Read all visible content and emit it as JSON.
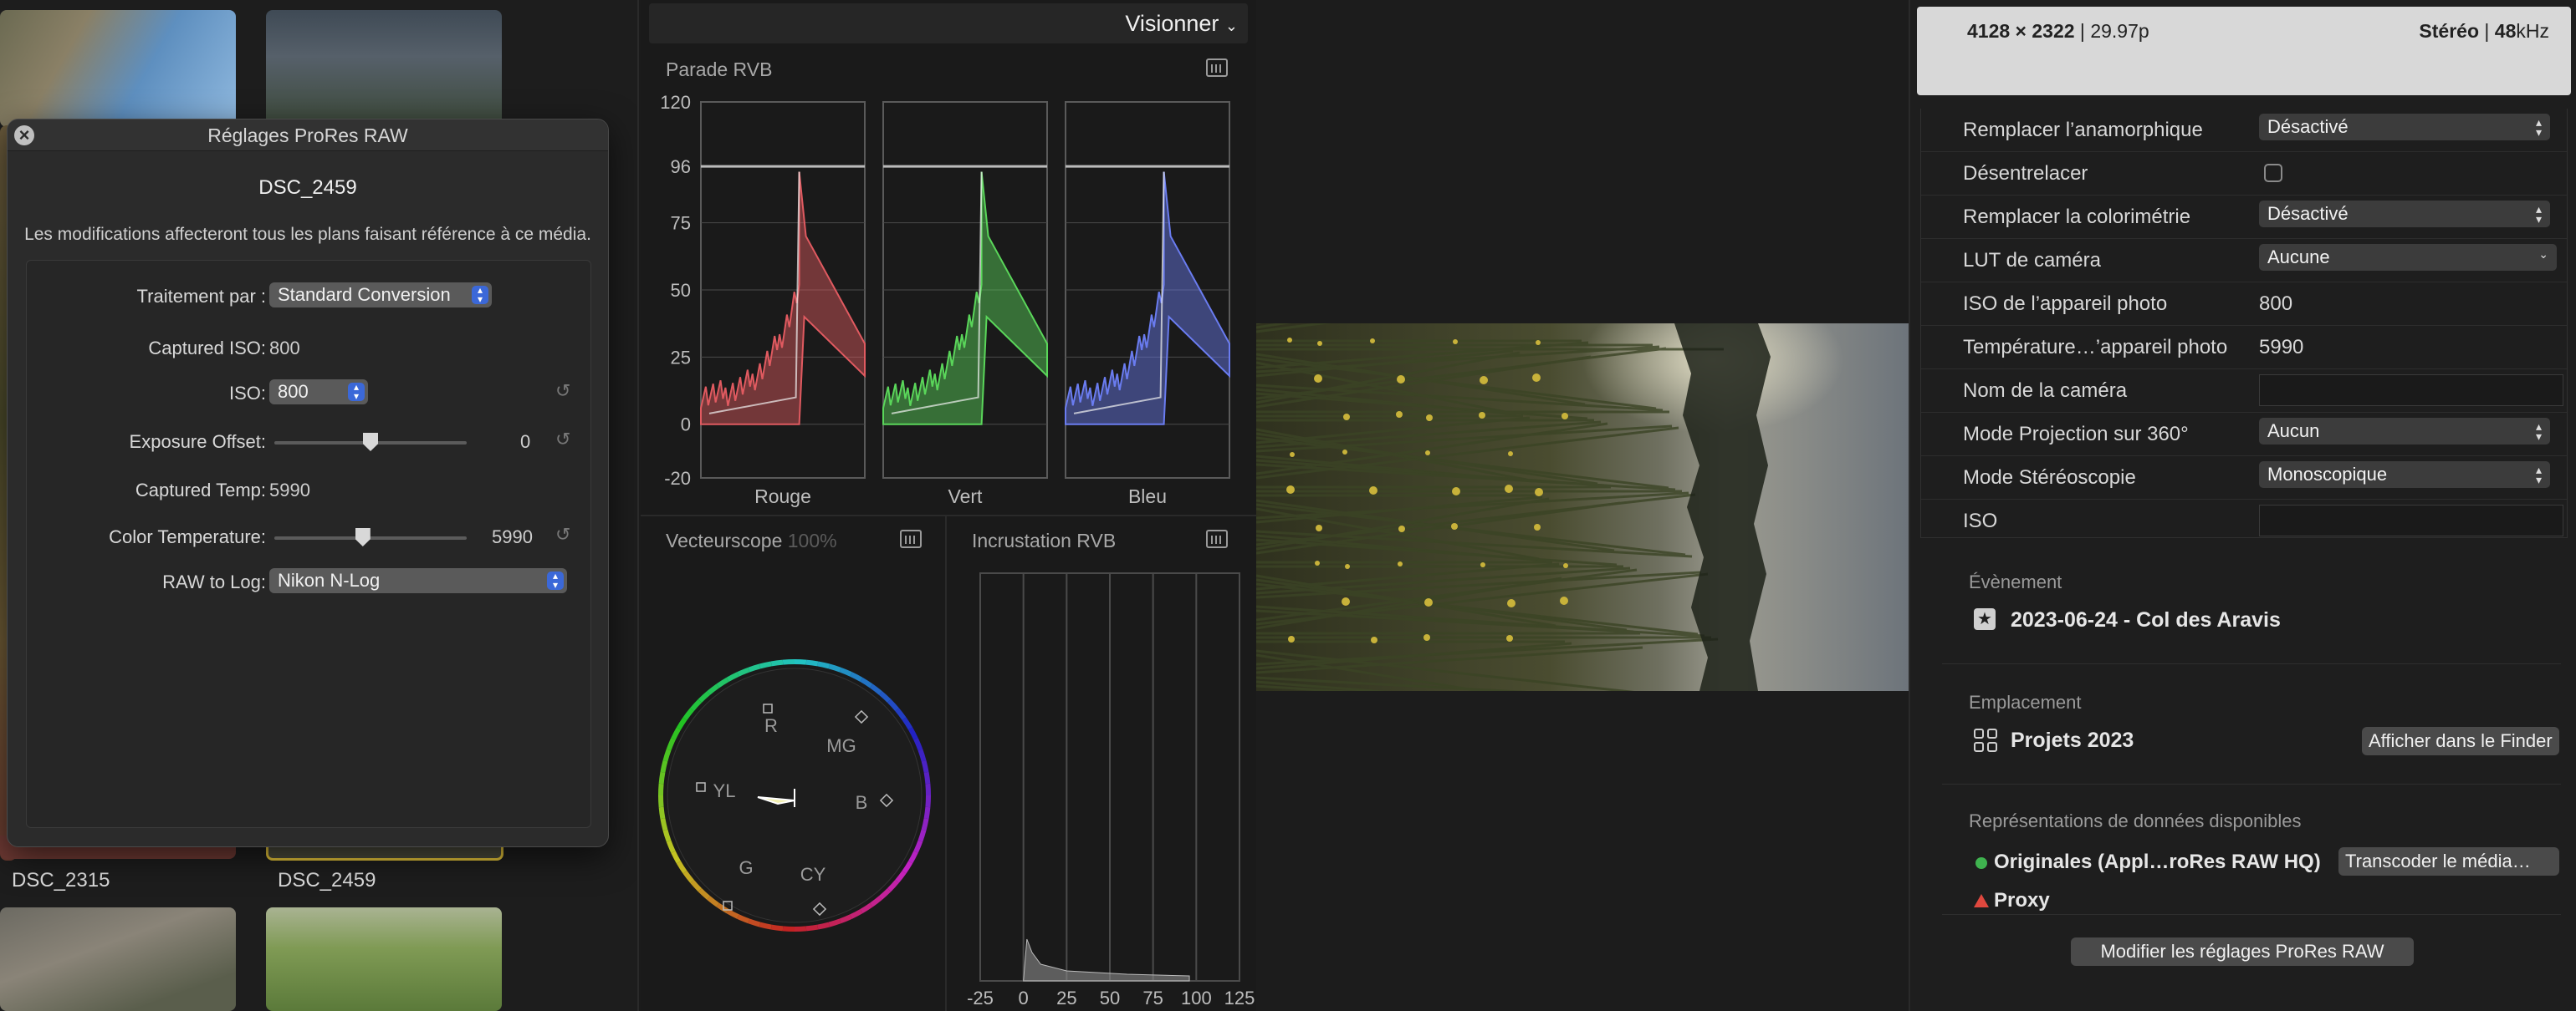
{
  "browser": {
    "clips": [
      {
        "name": "DSC_2315"
      },
      {
        "name": "DSC_2459"
      }
    ]
  },
  "dialog": {
    "title": "Réglages ProRes RAW",
    "clip_name": "DSC_2459",
    "notice": "Les modifications affecteront tous les plans faisant référence à ce média.",
    "processing_label": "Traitement par :",
    "processing_value": "Standard Conversion",
    "captured_iso_label": "Captured ISO:",
    "captured_iso_value": "800",
    "iso_label": "ISO:",
    "iso_value": "800",
    "exposure_label": "Exposure Offset:",
    "exposure_value": "0",
    "exposure_position": 0.5,
    "captured_temp_label": "Captured Temp:",
    "captured_temp_value": "5990",
    "color_temp_label": "Color Temperature:",
    "color_temp_value": "5990",
    "color_temp_position": 0.46,
    "raw_to_log_label": "RAW to Log:",
    "raw_to_log_value": "Nikon N-Log"
  },
  "scopes": {
    "viewer_menu": "Visionner",
    "parade": {
      "title": "Parade RVB",
      "ticks": [
        "120",
        "96",
        "75",
        "50",
        "25",
        "0",
        "-20"
      ],
      "channels": [
        "Rouge",
        "Vert",
        "Bleu"
      ]
    },
    "vectorscope": {
      "title": "Vecteurscope",
      "zoom": "100%",
      "labels": [
        "R",
        "MG",
        "YL",
        "B",
        "G",
        "CY"
      ]
    },
    "overlay": {
      "title": "Incrustation RVB",
      "ticks": [
        "-25",
        "0",
        "25",
        "50",
        "75",
        "100",
        "125"
      ]
    }
  },
  "inspector": {
    "header": {
      "resolution": "4128 × 2322",
      "frame_rate": "29.97p",
      "audio_channels": "Stéréo",
      "audio_rate": "48",
      "audio_unit": "kHz"
    },
    "rows": [
      {
        "label": "Remplacer l’anamorphique",
        "value": "Désactivé"
      },
      {
        "label": "Désentrelacer",
        "value": ""
      },
      {
        "label": "Remplacer la colorimétrie",
        "value": "Désactivé"
      },
      {
        "label": "LUT de caméra",
        "value": "Aucune"
      },
      {
        "label": "ISO de l’appareil photo",
        "value": "800"
      },
      {
        "label": "Température…’appareil photo",
        "value": "5990"
      },
      {
        "label": "Nom de la caméra",
        "value": ""
      },
      {
        "label": "Mode Projection sur 360°",
        "value": "Aucun"
      },
      {
        "label": "Mode Stéréoscopie",
        "value": "Monoscopique"
      },
      {
        "label": "ISO",
        "value": ""
      }
    ],
    "event_title": "Évènement",
    "event_value": "2023-06-24 - Col des Aravis",
    "location_title": "Emplacement",
    "location_value": "Projets 2023",
    "show_in_finder": "Afficher dans le Finder",
    "representations_title": "Représentations de données disponibles",
    "original": "Originales (Appl…roRes RAW HQ)",
    "transcode": "Transcoder le média…",
    "proxy": "Proxy",
    "modify_button": "Modifier les réglages ProRes RAW",
    "colors": {
      "original_dot": "#3fb34f",
      "proxy_triangle": "#e0483e"
    }
  }
}
